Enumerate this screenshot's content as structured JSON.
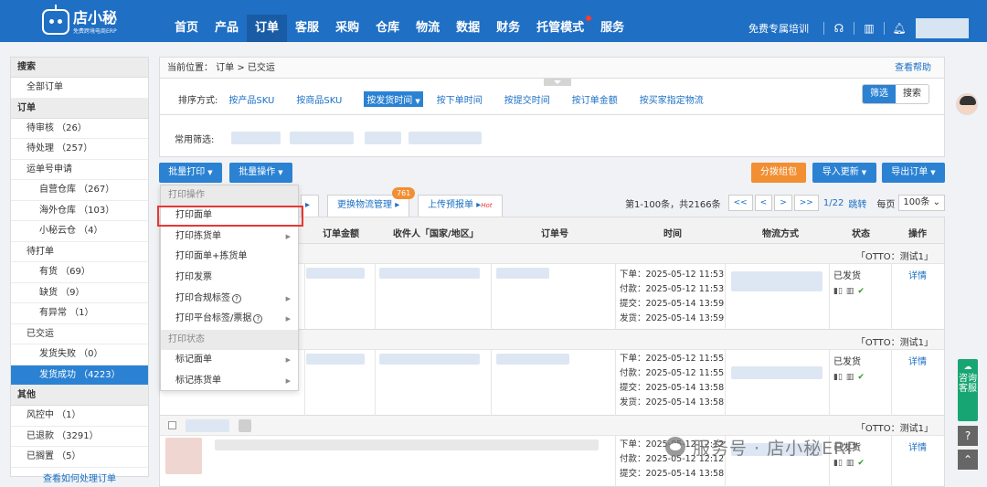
{
  "logo": {
    "brand": "店小秘",
    "slogan": "免费跨境电商ERP"
  },
  "nav": {
    "items": [
      {
        "label": "首页"
      },
      {
        "label": "产品"
      },
      {
        "label": "订单"
      },
      {
        "label": "客服"
      },
      {
        "label": "采购"
      },
      {
        "label": "仓库"
      },
      {
        "label": "物流"
      },
      {
        "label": "数据"
      },
      {
        "label": "财务"
      },
      {
        "label": "托管模式"
      },
      {
        "label": "服务"
      }
    ],
    "active": "订单",
    "training": "免费专属培训",
    "icons": [
      "headset-icon",
      "book-icon",
      "bell-icon"
    ]
  },
  "sidebar": {
    "search": "搜索",
    "all_orders": "全部订单",
    "order_section": "订单",
    "items": [
      "待审核 （26）",
      "待处理 （257）",
      "运单号申请",
      "自营仓库 （267）",
      "海外仓库 （103）",
      "小秘云仓 （4）",
      "待打单",
      "有货 （69）",
      "缺货 （9）",
      "有异常 （1）",
      "已交运",
      "发货失败 （0）",
      "发货成功 （4223）"
    ],
    "other_section": "其他",
    "other_items": [
      "风控中 （1）",
      "已退款 （3291）",
      "已搁置 （5）"
    ],
    "help": "查看如何处理订单"
  },
  "breadcrumb": {
    "text": "当前位置： 订单 > 已交运",
    "help": "查看帮助"
  },
  "sort": {
    "label": "排序方式:",
    "options": [
      "按产品SKU",
      "按商品SKU",
      "按发货时间",
      "按下单时间",
      "按提交时间",
      "按订单金额",
      "按买家指定物流"
    ],
    "active": "按发货时间"
  },
  "filter_buttons": {
    "filter": "筛选",
    "search": "搜索"
  },
  "common_filter": {
    "label": "常用筛选:"
  },
  "toolbar": {
    "batch_print": "批量打印",
    "batch_ops": "批量操作",
    "split_merge": "分拨组包",
    "import_update": "导入更新",
    "export_orders": "导出订单"
  },
  "tabs": {
    "change_logistics": "更换物流管理",
    "change_logistics_badge": "761",
    "upload_declaration": "上传预报单",
    "hot": "Hot"
  },
  "pager": {
    "summary": "第1-100条，共2166条",
    "first": "<<",
    "prev": "<",
    "next": ">",
    "last": ">>",
    "page": "1/22",
    "jump": "跳转",
    "per_page_label": "每页",
    "per_page": "100条"
  },
  "table": {
    "headers": [
      "订单金额",
      "收件人「国家/地区」",
      "订单号",
      "时间",
      "物流方式",
      "状态",
      "操作"
    ]
  },
  "orders": [
    {
      "store": "「OTTO：测试1」",
      "order_time": "下单：2025-05-12 11:53",
      "pay_time": "付款：2025-05-12 11:53",
      "submit_time": "提交：2025-05-14 13:59",
      "ship_time": "发货：2025-05-14 13:59",
      "status": "已发货",
      "action": "详情"
    },
    {
      "store": "「OTTO：测试1」",
      "order_time": "下单：2025-05-12 11:55",
      "pay_time": "付款：2025-05-12 11:55",
      "submit_time": "提交：2025-05-14 13:58",
      "ship_time": "发货：2025-05-14 13:58",
      "status": "已发货",
      "action": "详情"
    },
    {
      "store": "「OTTO：测试1」",
      "order_time": "下单：2025-05-12 12:12",
      "pay_time": "付款：2025-05-12 12:12",
      "submit_time": "提交：2025-05-14 13:58",
      "ship_time": "",
      "status": "已发货",
      "action": "详情"
    }
  ],
  "dropdown": {
    "print_header": "打印操作",
    "items": [
      "打印面单",
      "打印拣货单",
      "打印面单+拣货单",
      "打印发票",
      "打印合规标签",
      "打印平台标签/票据"
    ],
    "status_header": "打印状态",
    "status_items": [
      "标记面单",
      "标记拣货单"
    ],
    "highlight": "打印面单"
  },
  "consult": {
    "label": "咨询客服"
  },
  "watermark": "服务号 · 店小秘ERP",
  "colors": {
    "primary": "#1f6fc4",
    "accent": "#2b82d3",
    "orange": "#f28f32",
    "highlight": "#e53935",
    "consult": "#17a673"
  }
}
